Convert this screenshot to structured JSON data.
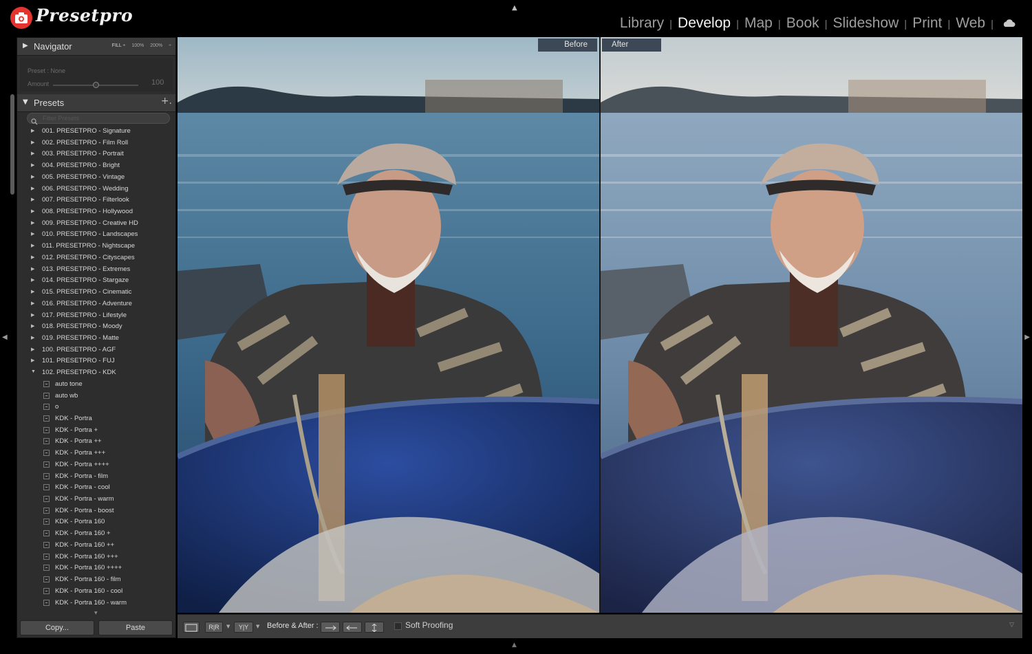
{
  "brand": {
    "name": "Presetpro",
    "accent": "#e3342f"
  },
  "modules": [
    {
      "label": "Library",
      "active": false
    },
    {
      "label": "Develop",
      "active": true
    },
    {
      "label": "Map",
      "active": false
    },
    {
      "label": "Book",
      "active": false
    },
    {
      "label": "Slideshow",
      "active": false
    },
    {
      "label": "Print",
      "active": false
    },
    {
      "label": "Web",
      "active": false
    }
  ],
  "module_separator": "|",
  "icons": {
    "cloud": "cloud-icon",
    "logo": "camera-icon",
    "search": "search-icon"
  },
  "navigator": {
    "title": "Navigator",
    "zoom_options": [
      "FILL ÷",
      "100%",
      "200%",
      "÷"
    ]
  },
  "preset_amount": {
    "preset_line": "Preset : None",
    "amount_label": "Amount",
    "amount_value": "100",
    "amount_fraction": 0.5
  },
  "presets": {
    "title": "Presets",
    "add_symbol": "+.",
    "filter_placeholder": "Filter Presets",
    "folders": [
      "001. PRESETPRO - Signature",
      "002. PRESETPRO - Film Roll",
      "003. PRESETPRO - Portrait",
      "004. PRESETPRO - Bright",
      "005. PRESETPRO - Vintage",
      "006. PRESETPRO - Wedding",
      "007. PRESETPRO - Filterlook",
      "008. PRESETPRO - Hollywood",
      "009. PRESETPRO - Creative HD",
      "010. PRESETPRO - Landscapes",
      "011. PRESETPRO - Nightscape",
      "012. PRESETPRO - Cityscapes",
      "013. PRESETPRO - Extremes",
      "014. PRESETPRO - Stargaze",
      "015. PRESETPRO - Cinematic",
      "016. PRESETPRO - Adventure",
      "017. PRESETPRO - Lifestyle",
      "018. PRESETPRO - Moody",
      "019. PRESETPRO - Matte",
      "100. PRESETPRO - AGF",
      "101. PRESETPRO - FUJ",
      "102. PRESETPRO - KDK"
    ],
    "expanded_folder": "102. PRESETPRO - KDK",
    "items": [
      "auto tone",
      "auto wb",
      "o",
      "KDK - Portra",
      "KDK - Portra +",
      "KDK - Portra ++",
      "KDK - Portra +++",
      "KDK - Portra ++++",
      "KDK - Portra - film",
      "KDK - Portra - cool",
      "KDK - Portra - warm",
      "KDK - Portra - boost",
      "KDK - Portra 160",
      "KDK - Portra 160 +",
      "KDK - Portra 160 ++",
      "KDK - Portra 160 +++",
      "KDK - Portra 160 ++++",
      "KDK - Portra 160 - film",
      "KDK - Portra 160 - cool",
      "KDK - Portra 160 - warm"
    ]
  },
  "left_buttons": {
    "copy": "Copy...",
    "paste": "Paste"
  },
  "view": {
    "before_label": "Before",
    "after_label": "After"
  },
  "toolbar": {
    "view_mode_labels": [
      "R|R",
      "Y|Y"
    ],
    "before_after_label": "Before & After :",
    "soft_proofing_label": "Soft Proofing",
    "soft_proofing_checked": false
  }
}
